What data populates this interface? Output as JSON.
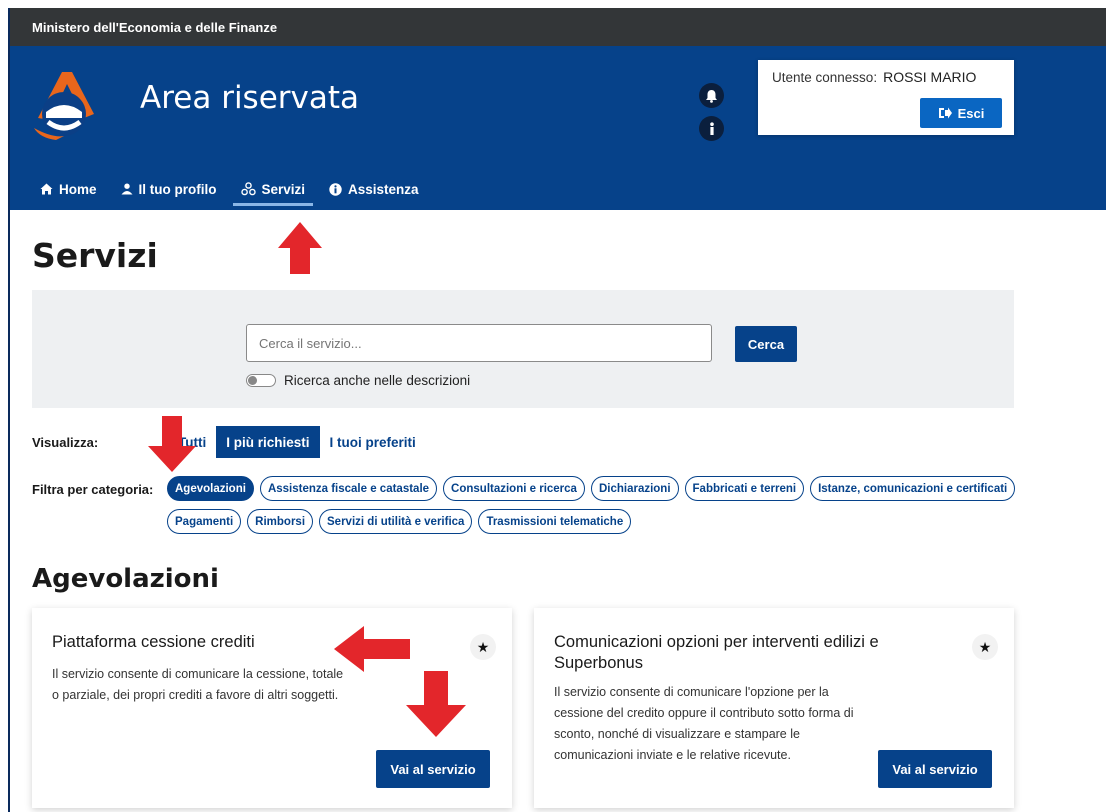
{
  "ministry_bar": {
    "text": "Ministero dell'Economia e delle Finanze"
  },
  "header": {
    "title": "Area riservata",
    "user_label": "Utente connesso:",
    "user_name": "ROSSI MARIO",
    "exit_label": "Esci"
  },
  "nav": {
    "items": [
      {
        "label": "Home",
        "icon": "home-icon"
      },
      {
        "label": "Il tuo profilo",
        "icon": "user-icon"
      },
      {
        "label": "Servizi",
        "icon": "services-icon",
        "active": true
      },
      {
        "label": "Assistenza",
        "icon": "info-icon"
      }
    ]
  },
  "page": {
    "title": "Servizi"
  },
  "search": {
    "placeholder": "Cerca il servizio...",
    "button_label": "Cerca",
    "toggle_label": "Ricerca anche nelle descrizioni"
  },
  "view": {
    "label": "Visualizza:",
    "options": [
      "Tutti",
      "I più richiesti",
      "I tuoi preferiti"
    ],
    "selected": "I più richiesti"
  },
  "filter": {
    "label": "Filtra per categoria:",
    "categories": [
      "Agevolazioni",
      "Assistenza fiscale e catastale",
      "Consultazioni e ricerca",
      "Dichiarazioni",
      "Fabbricati e terreni",
      "Istanze, comunicazioni e certificati",
      "Pagamenti",
      "Rimborsi",
      "Servizi di utilità e verifica",
      "Trasmissioni telematiche"
    ],
    "selected": "Agevolazioni"
  },
  "section": {
    "title": "Agevolazioni"
  },
  "cards": [
    {
      "title": "Piattaforma cessione crediti",
      "description": "Il servizio consente di comunicare la cessione, totale o parziale, dei propri crediti a favore di altri soggetti.",
      "button_label": "Vai al servizio"
    },
    {
      "title": "Comunicazioni opzioni per interventi edilizi e Superbonus",
      "description": "Il servizio consente di comunicare l'opzione per la cessione del credito oppure il contributo sotto forma di sconto, nonché di visualizzare e stampare le comunicazioni inviate e le relative ricevute.",
      "button_label": "Vai al servizio"
    }
  ],
  "colors": {
    "brand_blue": "#06428a",
    "ministry_bar": "#333638",
    "annotation_arrow": "#e3262b"
  }
}
